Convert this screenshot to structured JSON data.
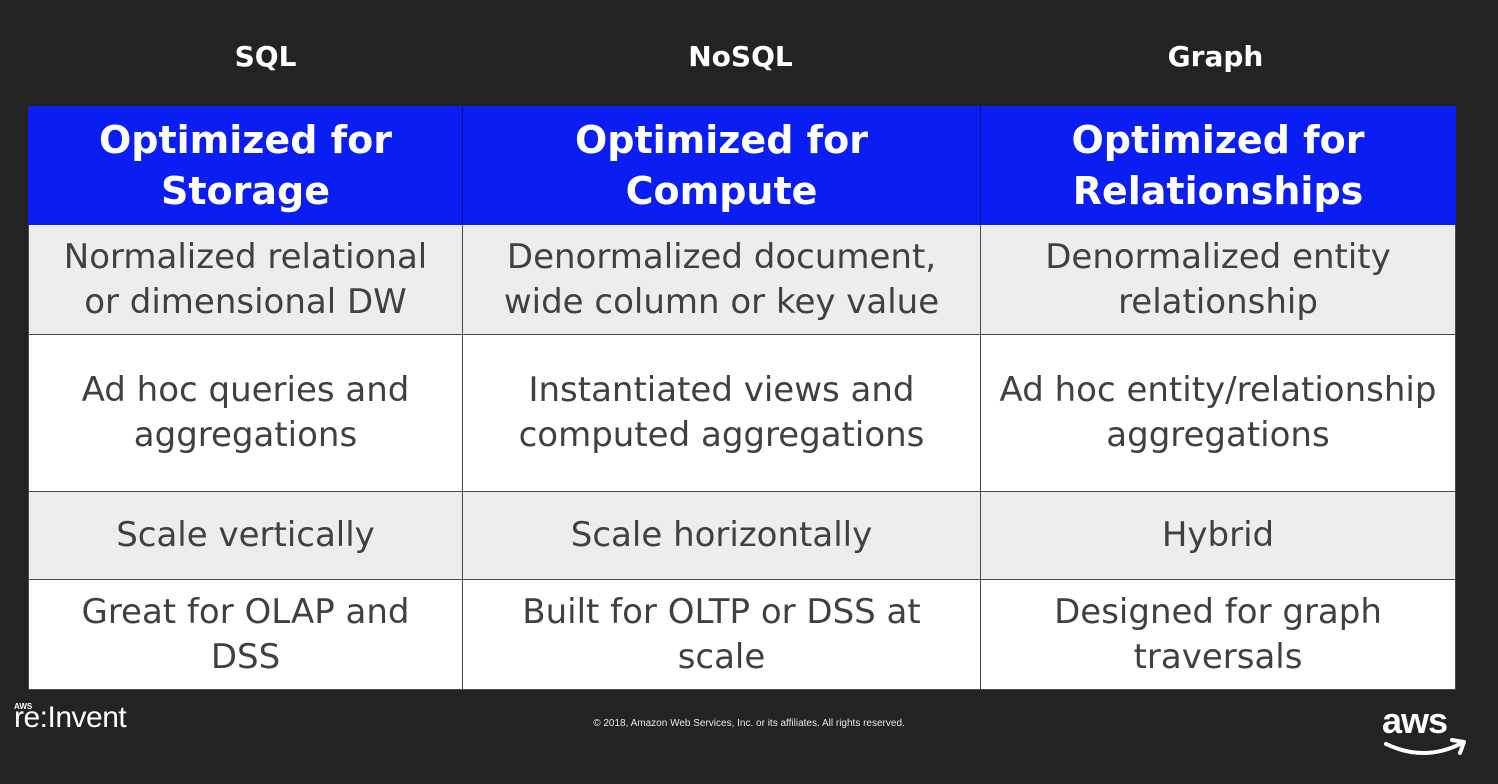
{
  "columns": [
    "SQL",
    "NoSQL",
    "Graph"
  ],
  "header_row": [
    "Optimized for Storage",
    "Optimized for Compute",
    "Optimized for Relationships"
  ],
  "rows": [
    [
      "Normalized relational or dimensional DW",
      "Denormalized document, wide column or key value",
      "Denormalized entity relationship"
    ],
    [
      "Ad hoc queries and aggregations",
      "Instantiated views and computed aggregations",
      "Ad hoc entity/relationship aggregations"
    ],
    [
      "Scale vertically",
      "Scale horizontally",
      "Hybrid"
    ],
    [
      "Great for OLAP and DSS",
      "Built for OLTP or DSS at scale",
      "Designed for graph traversals"
    ]
  ],
  "footer": {
    "reinvent_small": "AWS",
    "reinvent": "re:Invent",
    "copyright": "© 2018, Amazon Web Services, Inc. or its affiliates. All rights reserved.",
    "aws_logo": "aws"
  },
  "colors": {
    "header_blue": "#0a1df2",
    "background": "#232323",
    "shaded_row": "#ededed"
  }
}
